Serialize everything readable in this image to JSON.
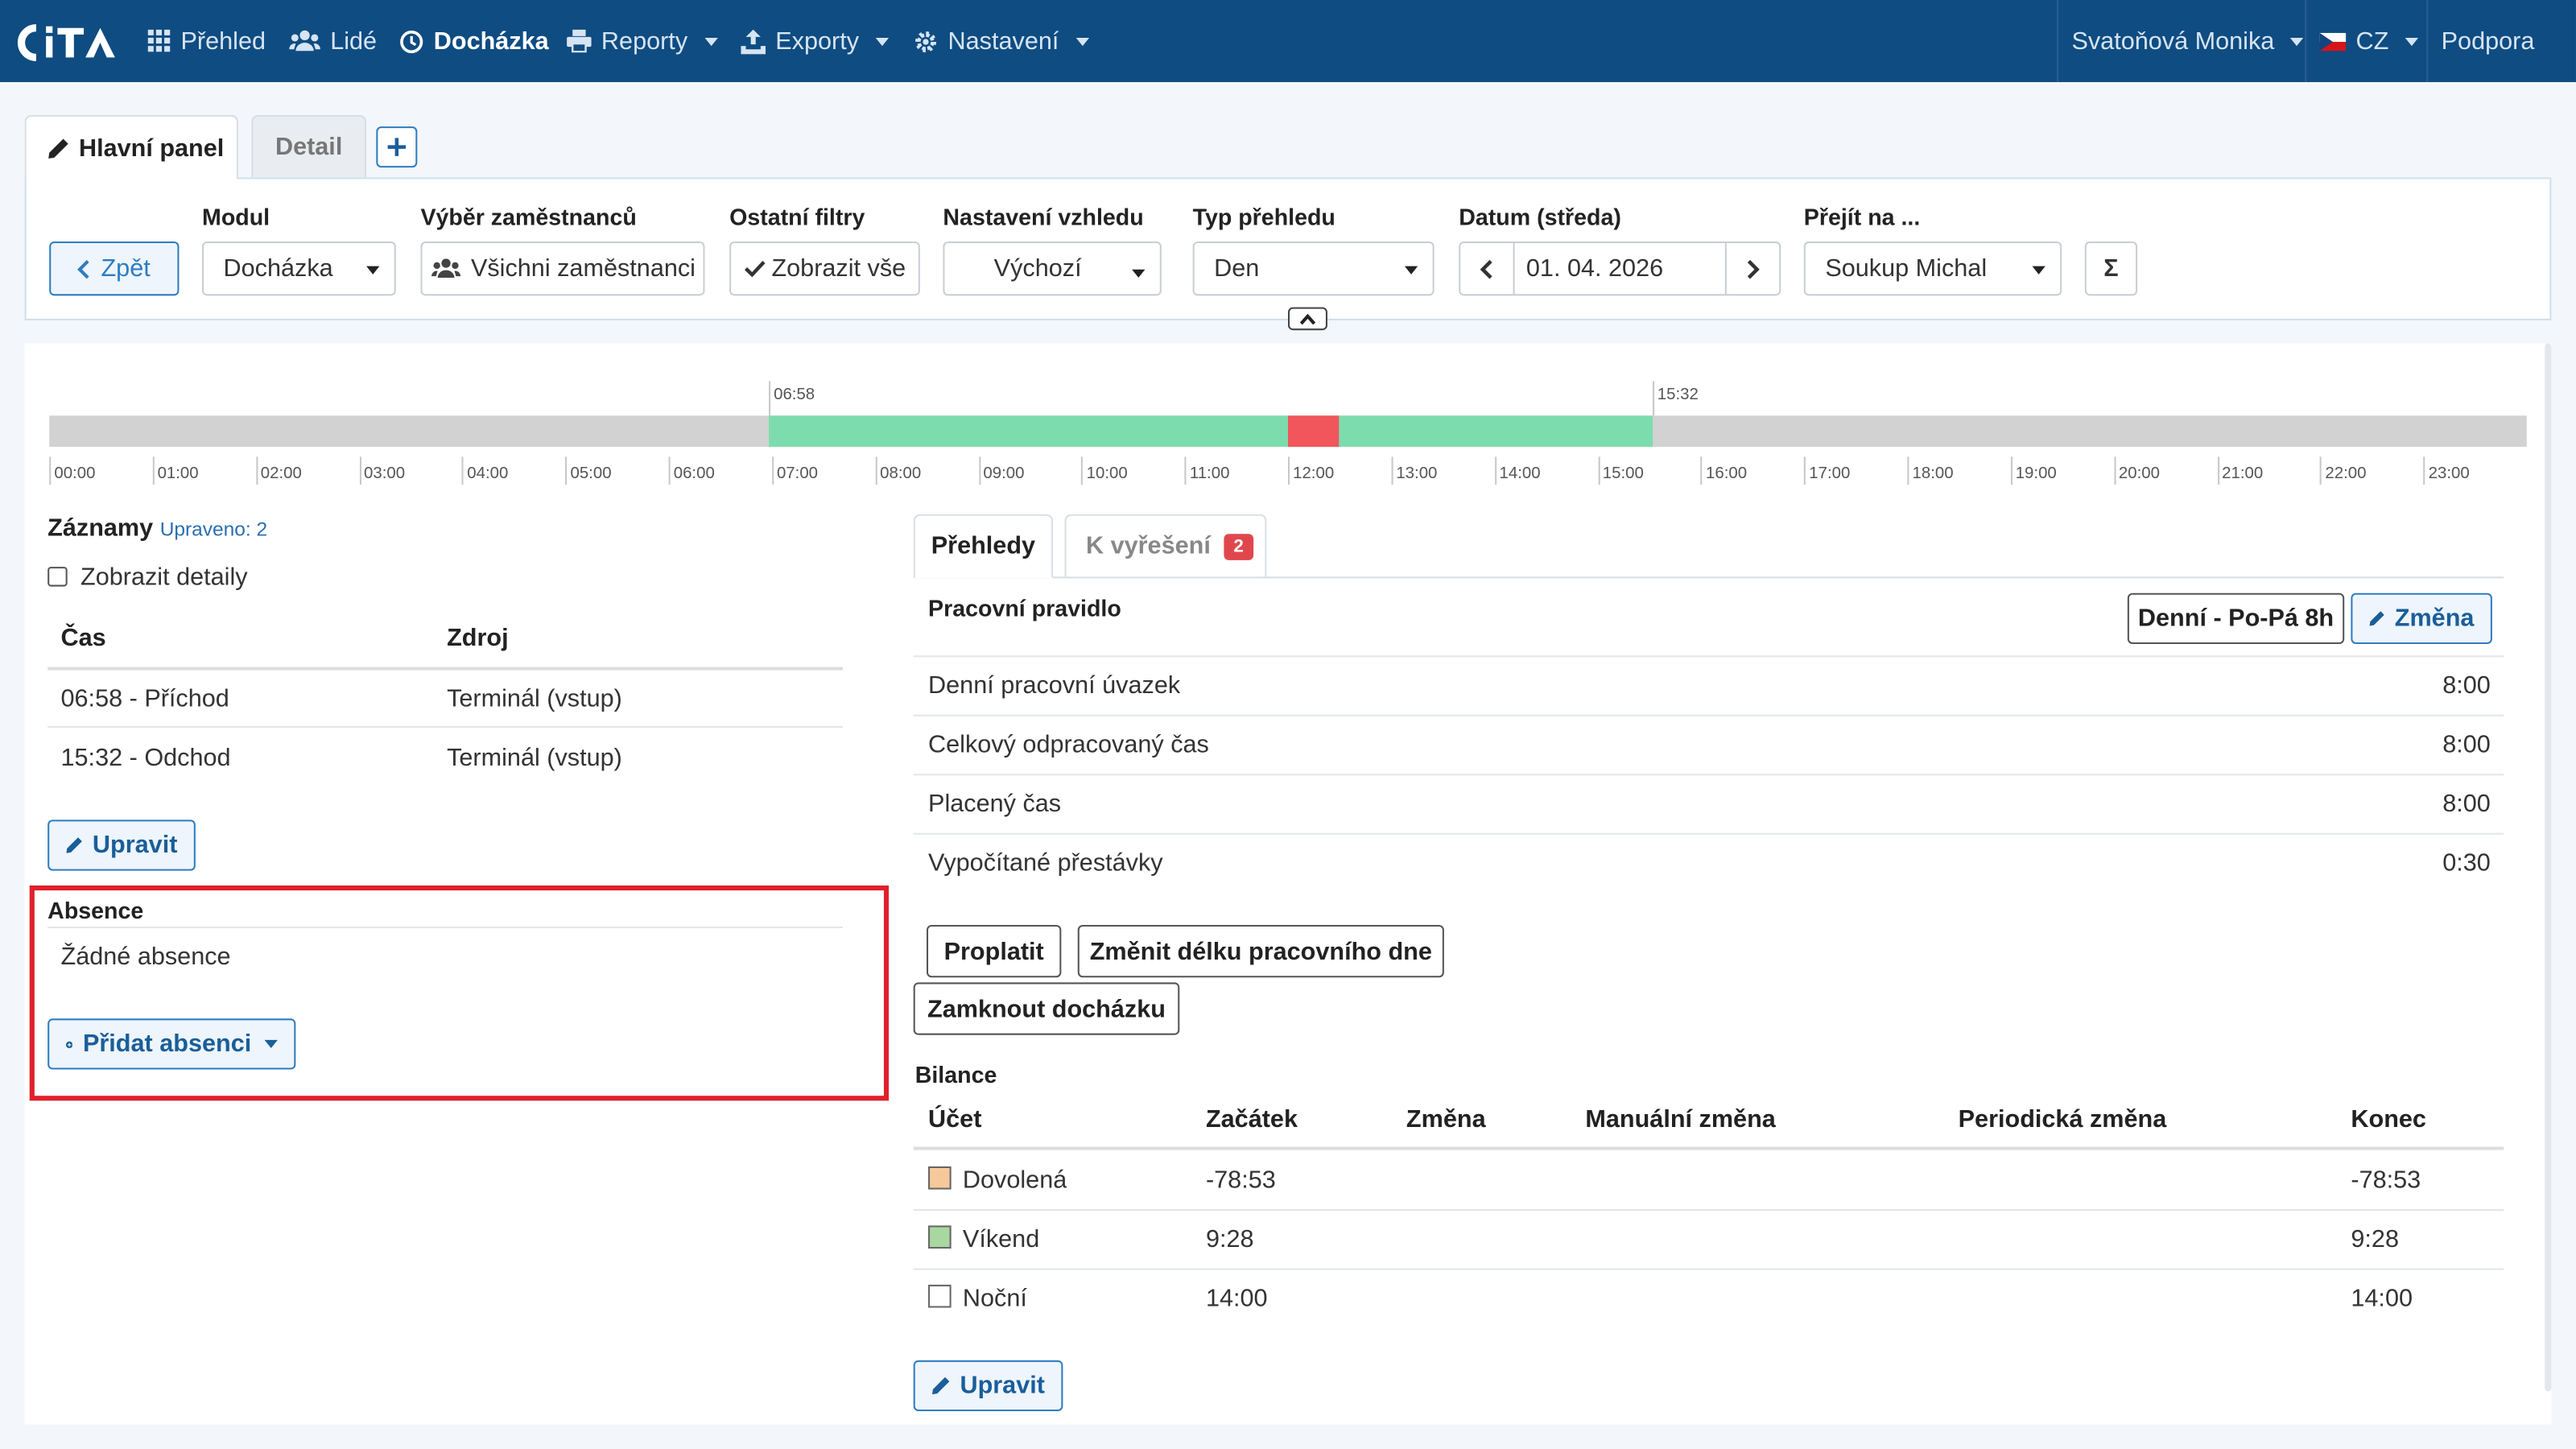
{
  "nav": {
    "items": [
      {
        "label": "Přehled",
        "icon": "grid-icon"
      },
      {
        "label": "Lidé",
        "icon": "users-icon"
      },
      {
        "label": "Docházka",
        "icon": "clock-icon"
      },
      {
        "label": "Reporty",
        "icon": "printer-icon"
      },
      {
        "label": "Exporty",
        "icon": "export-icon"
      },
      {
        "label": "Nastavení",
        "icon": "gear-icon"
      }
    ],
    "user": "Svatoňová Monika",
    "lang": "CZ",
    "support": "Podpora"
  },
  "tabs": {
    "main": "Hlavní panel",
    "detail": "Detail"
  },
  "filters": {
    "back": "Zpět",
    "module_label": "Modul",
    "module_value": "Docházka",
    "employees_label": "Výběr zaměstnanců",
    "employees_value": "Všichni zaměstnanci",
    "other_label": "Ostatní filtry",
    "other_value": "Zobrazit vše",
    "view_label": "Nastavení vzhledu",
    "view_value": "Výchozí",
    "type_label": "Typ přehledu",
    "type_value": "Den",
    "date_label": "Datum (středa)",
    "date_value": "01. 04. 2026",
    "goto_label": "Přejít na ...",
    "goto_value": "Soukup Michal",
    "sum_symbol": "Σ"
  },
  "timeline": {
    "start_label": "06:58",
    "end_label": "15:32",
    "start_hour": 6.97,
    "end_hour": 15.53,
    "break_start_hour": 12.0,
    "break_end_hour": 12.5,
    "hours": [
      "00:00",
      "01:00",
      "02:00",
      "03:00",
      "04:00",
      "05:00",
      "06:00",
      "07:00",
      "08:00",
      "09:00",
      "10:00",
      "11:00",
      "12:00",
      "13:00",
      "14:00",
      "15:00",
      "16:00",
      "17:00",
      "18:00",
      "19:00",
      "20:00",
      "21:00",
      "22:00",
      "23:00"
    ],
    "colors": {
      "idle": "#d2d2d2",
      "work": "#7ddcad",
      "break": "#f0565c"
    }
  },
  "records": {
    "title": "Záznamy",
    "modified": "Upraveno: 2",
    "show_details": "Zobrazit detaily",
    "col_time": "Čas",
    "col_source": "Zdroj",
    "rows": [
      {
        "time": "06:58 - Příchod",
        "source": "Terminál (vstup)"
      },
      {
        "time": "15:32 - Odchod",
        "source": "Terminál (vstup)"
      }
    ],
    "edit": "Upravit"
  },
  "absence": {
    "title": "Absence",
    "none": "Žádné absence",
    "add": "Přidat absenci"
  },
  "overview": {
    "tab_overview": "Přehledy",
    "tab_resolve": "K vyřešení",
    "resolve_count": "2",
    "rule_label": "Pracovní pravidlo",
    "rule_value": "Denní - Po-Pá 8h",
    "change": "Změna",
    "rows": [
      {
        "label": "Denní pracovní úvazek",
        "value": "8:00"
      },
      {
        "label": "Celkový odpracovaný čas",
        "value": "8:00"
      },
      {
        "label": "Placený čas",
        "value": "8:00"
      },
      {
        "label": "Vypočítané přestávky",
        "value": "0:30"
      }
    ],
    "btn_pay": "Proplatit",
    "btn_change_length": "Změnit délku pracovního dne",
    "btn_lock": "Zamknout docházku"
  },
  "balance": {
    "title": "Bilance",
    "cols": [
      "Účet",
      "Začátek",
      "Změna",
      "Manuální změna",
      "Periodická změna",
      "Konec"
    ],
    "rows": [
      {
        "name": "Dovolená",
        "start": "-78:53",
        "end": "-78:53",
        "color": "#f7c99a"
      },
      {
        "name": "Víkend",
        "start": "9:28",
        "end": "9:28",
        "color": "#a8d8a0"
      },
      {
        "name": "Noční",
        "start": "14:00",
        "end": "14:00",
        "color": "#ffffff"
      }
    ],
    "edit": "Upravit"
  }
}
